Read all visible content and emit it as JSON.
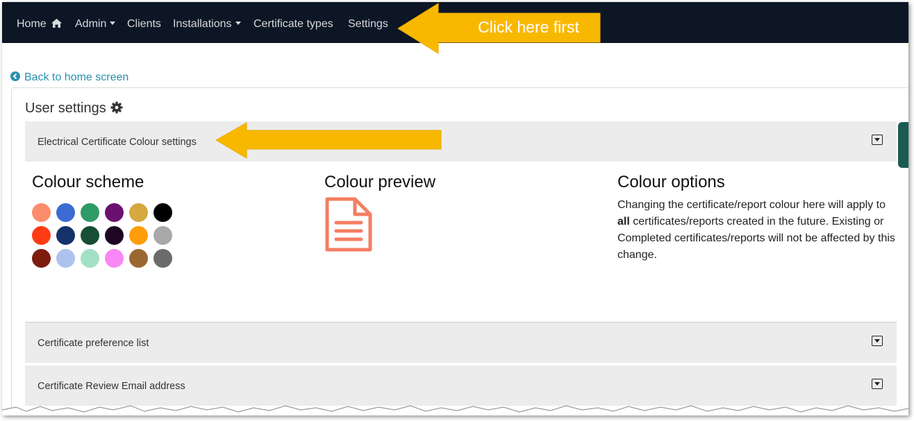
{
  "navbar": {
    "items": [
      {
        "label": "Home",
        "has_caret": false
      },
      {
        "label": "Admin",
        "has_caret": true
      },
      {
        "label": "Clients",
        "has_caret": false
      },
      {
        "label": "Installations",
        "has_caret": true
      },
      {
        "label": "Certificate types",
        "has_caret": false
      },
      {
        "label": "Settings",
        "has_caret": false
      }
    ],
    "home_icon": "home-icon",
    "background": "#0d1624"
  },
  "annotations": {
    "top_callout": "Click here first",
    "arrow_color": "#f9b800"
  },
  "back_link": {
    "label": "Back to home screen",
    "icon": "arrow-circle-left-icon"
  },
  "card": {
    "title": "User settings",
    "title_icon": "gear-icon"
  },
  "accordion": [
    {
      "label": "Electrical Certificate Colour settings",
      "expanded": true
    },
    {
      "label": "Certificate preference list",
      "expanded": false
    },
    {
      "label": "Certificate Review Email address",
      "expanded": false
    }
  ],
  "colour_scheme": {
    "heading": "Colour scheme",
    "swatches": [
      "#fb8c6c",
      "#3b6bd3",
      "#2e9a66",
      "#6a1170",
      "#d5a840",
      "#000000",
      "#ff3b14",
      "#15326a",
      "#164e36",
      "#1d0723",
      "#ff9e0a",
      "#a8a8a8",
      "#7d1c0c",
      "#aec2ee",
      "#a2e0c4",
      "#f987f5",
      "#9b6730",
      "#6b6b6b"
    ]
  },
  "colour_preview": {
    "heading": "Colour preview",
    "icon": "document-icon",
    "color": "#f47e62"
  },
  "colour_options": {
    "heading": "Colour options",
    "text_before": "Changing the certificate/report colour here will apply to ",
    "text_bold": "all",
    "text_after": " certificates/reports created in the future. Existing or Completed certificates/reports will not be affected by this change."
  }
}
